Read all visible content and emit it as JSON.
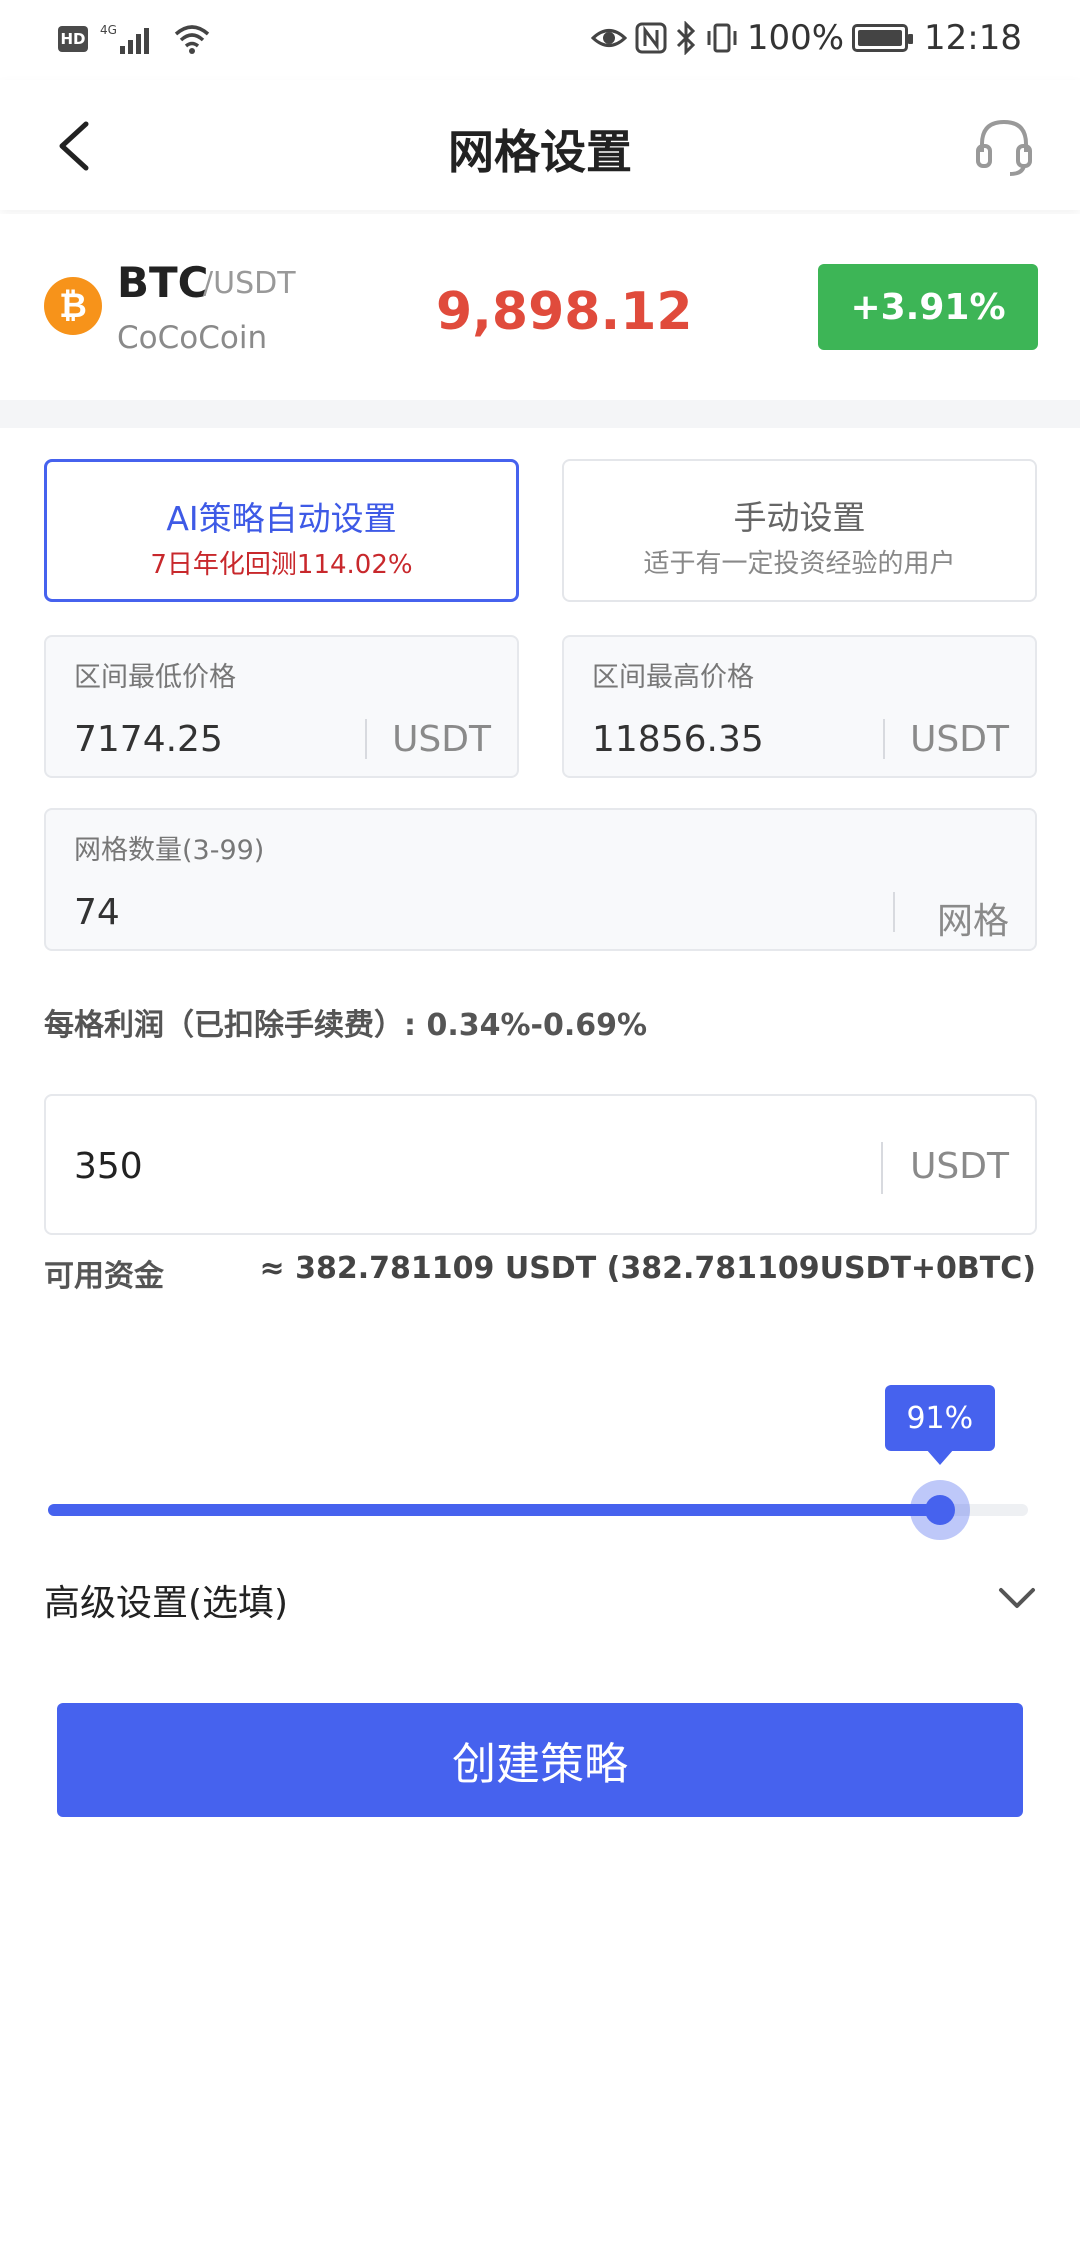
{
  "status_bar": {
    "hd": "HD",
    "network": "4G",
    "battery_pct": "100%",
    "time": "12:18"
  },
  "nav": {
    "title": "网格设置",
    "back_icon": "chevron-left-icon",
    "support_icon": "headset-icon"
  },
  "ticker": {
    "base": "BTC",
    "quote": "/USDT",
    "exchange": "CoCoCoin",
    "price": "9,898.12",
    "change": "+3.91%",
    "coin_icon": "bitcoin-icon",
    "colors": {
      "price": "#e04b3c",
      "change_bg": "#3db556"
    }
  },
  "modes": {
    "ai": {
      "title": "AI策略自动设置",
      "subtitle": "7日年化回测114.02%"
    },
    "manual": {
      "title": "手动设置",
      "subtitle": "适于有一定投资经验的用户"
    },
    "selected": "ai"
  },
  "fields": {
    "low": {
      "label": "区间最低价格",
      "value": "7174.25",
      "unit": "USDT"
    },
    "high": {
      "label": "区间最高价格",
      "value": "11856.35",
      "unit": "USDT"
    },
    "grid": {
      "label": "网格数量(3-99)",
      "value": "74",
      "unit": "网格"
    }
  },
  "profit_text": "每格利润（已扣除手续费）:  0.34%-0.69%",
  "amount": {
    "value": "350",
    "unit": "USDT"
  },
  "available": {
    "label": "可用资金",
    "value": "≈ 382.781109 USDT (382.781109USDT+0BTC)"
  },
  "slider": {
    "percent": 91,
    "label": "91%"
  },
  "advanced": {
    "label": "高级设置(选填)",
    "icon": "chevron-down-icon"
  },
  "create_button": "创建策略",
  "accent_color": "#4662ee"
}
